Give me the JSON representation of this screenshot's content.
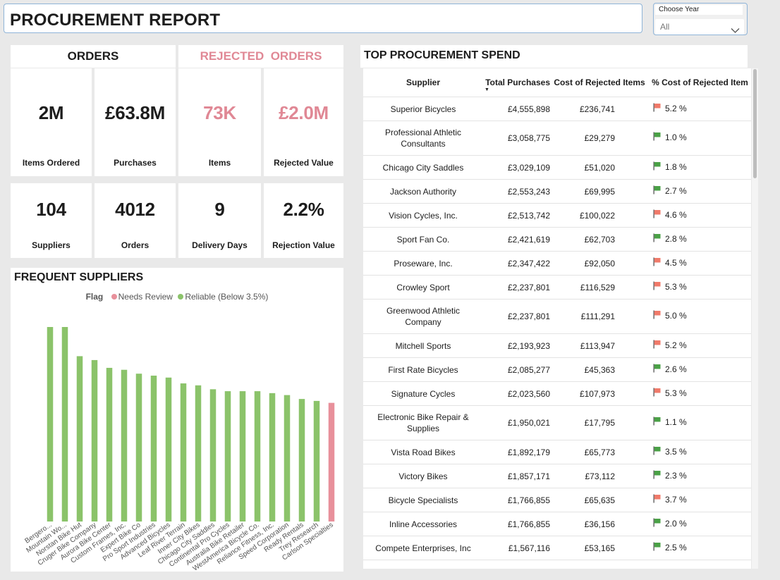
{
  "header": {
    "title": "PROCUREMENT REPORT"
  },
  "filter": {
    "label": "Choose Year",
    "value": "All"
  },
  "orders": {
    "heading": "ORDERS",
    "items_ordered": {
      "value": "2M",
      "label": "Items Ordered"
    },
    "purchases": {
      "value": "£63.8M",
      "label": "Purchases"
    }
  },
  "rejected": {
    "heading": "REJECTED  ORDERS",
    "items": {
      "value": "73K",
      "label": "Items"
    },
    "rejected_value": {
      "value": "£2.0M",
      "label": "Rejected Value"
    }
  },
  "stats": {
    "suppliers": {
      "value": "104",
      "label": "Suppliers"
    },
    "orders": {
      "value": "4012",
      "label": "Orders"
    },
    "delivery_days": {
      "value": "9",
      "label": "Delivery Days"
    },
    "rejection_value": {
      "value": "2.2%",
      "label": "Rejection Value"
    }
  },
  "colors": {
    "accent_pink": "#e08895",
    "reliable_green": "#8bc36a",
    "needs_review": "#e8909b",
    "flag_red": "#f07a6a",
    "flag_green": "#4aa146"
  },
  "chart_data": {
    "type": "bar",
    "title": "FREQUENT SUPPLIERS",
    "legend": {
      "title": "Flag",
      "items": [
        "Needs Review",
        "Reliable (Below 3.5%)"
      ],
      "position": "top"
    },
    "categories": [
      "Bergero...",
      "Mountain Wo...",
      "Norstan Bike Hut",
      "Cruger Bike Company",
      "Aurora Bike Center",
      "Custom Frames, Inc.",
      "Expert Bike Co",
      "Pro Sport Industries",
      "Advanced Bicycles",
      "Leaf River Terrain",
      "Inner City Bikes",
      "Chicago City Saddles",
      "Continental Pro Cycles",
      "Australia Bike Retailer",
      "WestAmerica Bicycle Co.",
      "Reliance Fitness, Inc.",
      "Speed Corporation",
      "Ready Rentals",
      "Trey Research",
      "Carlson Specialties"
    ],
    "values": [
      100,
      100,
      85,
      83,
      79,
      78,
      76,
      75,
      74,
      71,
      70,
      68,
      67,
      67,
      67,
      66,
      65,
      63,
      62,
      61
    ],
    "flags": [
      "Reliable (Below 3.5%)",
      "Reliable (Below 3.5%)",
      "Reliable (Below 3.5%)",
      "Reliable (Below 3.5%)",
      "Reliable (Below 3.5%)",
      "Reliable (Below 3.5%)",
      "Reliable (Below 3.5%)",
      "Reliable (Below 3.5%)",
      "Reliable (Below 3.5%)",
      "Reliable (Below 3.5%)",
      "Reliable (Below 3.5%)",
      "Reliable (Below 3.5%)",
      "Reliable (Below 3.5%)",
      "Reliable (Below 3.5%)",
      "Reliable (Below 3.5%)",
      "Reliable (Below 3.5%)",
      "Reliable (Below 3.5%)",
      "Reliable (Below 3.5%)",
      "Reliable (Below 3.5%)",
      "Needs Review"
    ],
    "ylim": [
      0,
      100
    ],
    "grid": false
  },
  "table": {
    "title": "TOP PROCUREMENT SPEND",
    "columns": [
      "Supplier",
      "Total Purchases",
      "Cost of Rejected Items",
      "% Cost of Rejected Item"
    ],
    "sort_column": "Total Purchases",
    "rows": [
      {
        "supplier": "Superior Bicycles",
        "total": "£4,555,898",
        "cost": "£236,741",
        "pct": "5.2 %",
        "flag": "red"
      },
      {
        "supplier": "Professional Athletic Consultants",
        "total": "£3,058,775",
        "cost": "£29,279",
        "pct": "1.0 %",
        "flag": "green"
      },
      {
        "supplier": "Chicago City Saddles",
        "total": "£3,029,109",
        "cost": "£51,020",
        "pct": "1.8 %",
        "flag": "green"
      },
      {
        "supplier": "Jackson Authority",
        "total": "£2,553,243",
        "cost": "£69,995",
        "pct": "2.7 %",
        "flag": "green"
      },
      {
        "supplier": "Vision Cycles, Inc.",
        "total": "£2,513,742",
        "cost": "£100,022",
        "pct": "4.6 %",
        "flag": "red"
      },
      {
        "supplier": "Sport Fan Co.",
        "total": "£2,421,619",
        "cost": "£62,703",
        "pct": "2.8 %",
        "flag": "green"
      },
      {
        "supplier": "Proseware, Inc.",
        "total": "£2,347,422",
        "cost": "£92,050",
        "pct": "4.5 %",
        "flag": "red"
      },
      {
        "supplier": "Crowley Sport",
        "total": "£2,237,801",
        "cost": "£116,529",
        "pct": "5.3 %",
        "flag": "red"
      },
      {
        "supplier": "Greenwood Athletic Company",
        "total": "£2,237,801",
        "cost": "£111,291",
        "pct": "5.0 %",
        "flag": "red"
      },
      {
        "supplier": "Mitchell Sports",
        "total": "£2,193,923",
        "cost": "£113,947",
        "pct": "5.2 %",
        "flag": "red"
      },
      {
        "supplier": "First Rate Bicycles",
        "total": "£2,085,277",
        "cost": "£45,363",
        "pct": "2.6 %",
        "flag": "green"
      },
      {
        "supplier": "Signature Cycles",
        "total": "£2,023,560",
        "cost": "£107,973",
        "pct": "5.3 %",
        "flag": "red"
      },
      {
        "supplier": "Electronic Bike Repair & Supplies",
        "total": "£1,950,021",
        "cost": "£17,795",
        "pct": "1.1 %",
        "flag": "green"
      },
      {
        "supplier": "Vista Road Bikes",
        "total": "£1,892,179",
        "cost": "£65,773",
        "pct": "3.5 %",
        "flag": "green"
      },
      {
        "supplier": "Victory Bikes",
        "total": "£1,857,171",
        "cost": "£73,112",
        "pct": "2.3 %",
        "flag": "green"
      },
      {
        "supplier": "Bicycle Specialists",
        "total": "£1,766,855",
        "cost": "£65,635",
        "pct": "3.7 %",
        "flag": "red"
      },
      {
        "supplier": "Inline Accessories",
        "total": "£1,766,855",
        "cost": "£36,156",
        "pct": "2.0 %",
        "flag": "green"
      },
      {
        "supplier": "Compete Enterprises, Inc",
        "total": "£1,567,116",
        "cost": "£53,165",
        "pct": "2.5 %",
        "flag": "green"
      }
    ]
  }
}
